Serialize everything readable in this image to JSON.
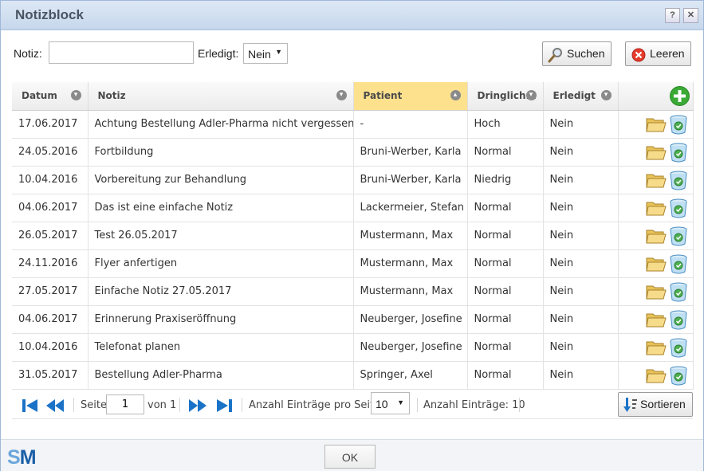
{
  "window": {
    "title": "Notizblock",
    "help_label": "?",
    "close_label": "✕"
  },
  "filter": {
    "notiz_label": "Notiz:",
    "notiz_value": "",
    "erledigt_label": "Erledigt:",
    "erledigt_value": "Nein",
    "search_label": "Suchen",
    "clear_label": "Leeren"
  },
  "table": {
    "columns": [
      "Datum",
      "Notiz",
      "Patient",
      "Dringlich...",
      "Erledigt"
    ],
    "sorted_column": "Patient",
    "rows": [
      [
        "17.06.2017",
        "Achtung Bestellung Adler-Pharma nicht vergessen",
        "-",
        "Hoch",
        "Nein"
      ],
      [
        "24.05.2016",
        "Fortbildung",
        "Bruni-Werber, Karla",
        "Normal",
        "Nein"
      ],
      [
        "10.04.2016",
        "Vorbereitung zur Behandlung",
        "Bruni-Werber, Karla",
        "Niedrig",
        "Nein"
      ],
      [
        "04.06.2017",
        "Das ist eine einfache Notiz",
        "Lackermeier, Stefan",
        "Normal",
        "Nein"
      ],
      [
        "26.05.2017",
        "Test 26.05.2017",
        "Mustermann, Max",
        "Normal",
        "Nein"
      ],
      [
        "24.11.2016",
        "Flyer anfertigen",
        "Mustermann, Max",
        "Normal",
        "Nein"
      ],
      [
        "27.05.2017",
        "Einfache Notiz 27.05.2017",
        "Mustermann, Max",
        "Normal",
        "Nein"
      ],
      [
        "04.06.2017",
        "Erinnerung Praxiseröffnung",
        "Neuberger, Josefine",
        "Normal",
        "Nein"
      ],
      [
        "10.04.2016",
        "Telefonat planen",
        "Neuberger, Josefine",
        "Normal",
        "Nein"
      ],
      [
        "31.05.2017",
        "Bestellung Adler-Pharma",
        "Springer, Axel",
        "Normal",
        "Nein"
      ]
    ]
  },
  "pager": {
    "seite_label": "Seite",
    "page": "1",
    "von_label": "von 1",
    "per_page_label": "Anzahl Einträge pro Seite:",
    "per_page_value": "10",
    "count_label": "Anzahl Einträge: 10",
    "sort_label": "Sortieren"
  },
  "footer": {
    "ok_label": "OK",
    "logo_s": "S",
    "logo_m": "M"
  },
  "colors": {
    "accent": "#1a73c7",
    "sorted_header": "#fde18d",
    "add_green": "#3aaa35"
  }
}
